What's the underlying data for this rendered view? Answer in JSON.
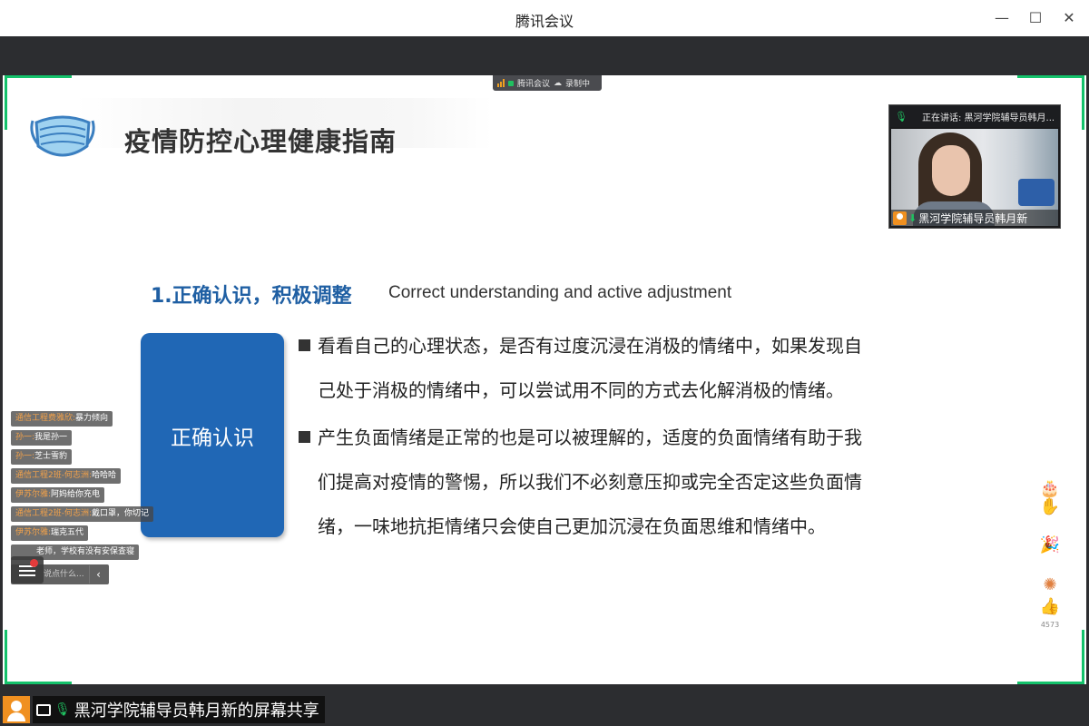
{
  "window": {
    "title": "腾讯会议",
    "min_glyph": "—",
    "max_glyph": "☐",
    "close_glyph": "✕"
  },
  "recording_pill": {
    "app_label": "腾讯会议",
    "recording_label": "录制中"
  },
  "slide": {
    "title": "疫情防控心理健康指南",
    "section_heading": "1.正确认识，积极调整",
    "section_heading_en": "Correct understanding and active adjustment",
    "box_label": "正确认识",
    "bullet1_line1": "看看自己的心理状态，是否有过度沉浸在消极的情绪中，如果发现自",
    "bullet1_line2": "己处于消极的情绪中，可以尝试用不同的方式去化解消极的情绪。",
    "bullet2_line1": "产生负面情绪是正常的也是可以被理解的，适度的负面情绪有助于我",
    "bullet2_line2": "们提高对疫情的警惕，所以我们不必刻意压抑或完全否定这些负面情",
    "bullet2_line3": "绪，一味地抗拒情绪只会使自己更加沉浸在负面思维和情绪中。"
  },
  "speaker": {
    "speaking_label": "正在讲话: 黑河学院辅导员韩月...",
    "name": "黑河学院辅导员韩月新"
  },
  "chat": {
    "messages": [
      {
        "name": "通信工程费雅欣:",
        "msg": "暴力倾向"
      },
      {
        "name": "孙一:",
        "msg": "我是孙一"
      },
      {
        "name": "孙一:",
        "msg": "芝士雪豹"
      },
      {
        "name": "通信工程2班-何志洲:",
        "msg": "哈哈哈"
      },
      {
        "name": "伊苏尔雅:",
        "msg": "阿妈给你充电"
      },
      {
        "name": "通信工程2班-何志洲:",
        "msg": "戴口罩，你切记"
      },
      {
        "name": "伊苏尔雅:",
        "msg": "瑞克五代"
      },
      {
        "name": "",
        "msg": "老师，学校有没有安保查寝"
      }
    ],
    "input_placeholder": "说点什么...",
    "collapse_glyph": "‹"
  },
  "reactions": {
    "like_count": "4573",
    "icons": [
      "cake-icon",
      "hand-icon",
      "party-popper-icon",
      "fireworks-icon",
      "thumbs-up-icon"
    ]
  },
  "share_label": {
    "text": "黑河学院辅导员韩月新的屏幕共享"
  },
  "colors": {
    "accent_green": "#14c26b",
    "slide_blue": "#2067b5",
    "heading_blue": "#1f5fa3",
    "chat_name_orange": "#f3a24a",
    "avatar_orange": "#f09020"
  }
}
